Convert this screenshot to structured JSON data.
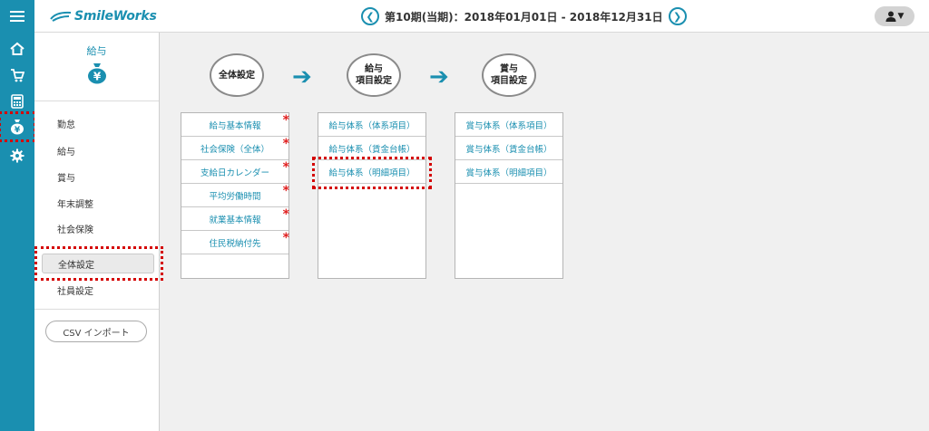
{
  "header": {
    "logo_text": "SmileWorks",
    "period": "第10期(当期)：2018年01月01日 - 2018年12月31日",
    "prev_icon": "chevron-left-icon",
    "next_icon": "chevron-right-icon",
    "user_icon": "user-icon"
  },
  "rail": {
    "items": [
      {
        "icon": "home-icon"
      },
      {
        "icon": "cart-icon"
      },
      {
        "icon": "calculator-icon"
      },
      {
        "icon": "moneybag-yen-icon"
      },
      {
        "icon": "gear-icon"
      }
    ]
  },
  "submenu": {
    "title": "給与",
    "items": [
      {
        "label": "勤怠"
      },
      {
        "label": "給与"
      },
      {
        "label": "賞与"
      },
      {
        "label": "年末調整"
      },
      {
        "label": "社会保険"
      },
      {
        "label": "全体設定"
      },
      {
        "label": "社員設定"
      }
    ],
    "csv_button": "CSV インポート"
  },
  "steps": [
    {
      "label": "全体設定"
    },
    {
      "label": "給与\n項目設定"
    },
    {
      "label": "賞与\n項目設定"
    }
  ],
  "columns": {
    "general": [
      {
        "label": "給与基本情報",
        "required": "*"
      },
      {
        "label": "社会保険（全体）",
        "required": "*"
      },
      {
        "label": "支給日カレンダー",
        "required": "*"
      },
      {
        "label": "平均労働時間",
        "required": "*"
      },
      {
        "label": "就業基本情報",
        "required": "*"
      },
      {
        "label": "住民税納付先",
        "required": "*"
      }
    ],
    "salary": [
      {
        "label": "給与体系（体系項目）"
      },
      {
        "label": "給与体系（賃金台帳）"
      },
      {
        "label": "給与体系（明細項目）"
      }
    ],
    "bonus": [
      {
        "label": "賞与体系（体系項目）"
      },
      {
        "label": "賞与体系（賃金台帳）"
      },
      {
        "label": "賞与体系（明細項目）"
      }
    ]
  },
  "colors": {
    "accent": "#1a8fb0",
    "highlight": "#d40000",
    "required": "#e02020"
  }
}
